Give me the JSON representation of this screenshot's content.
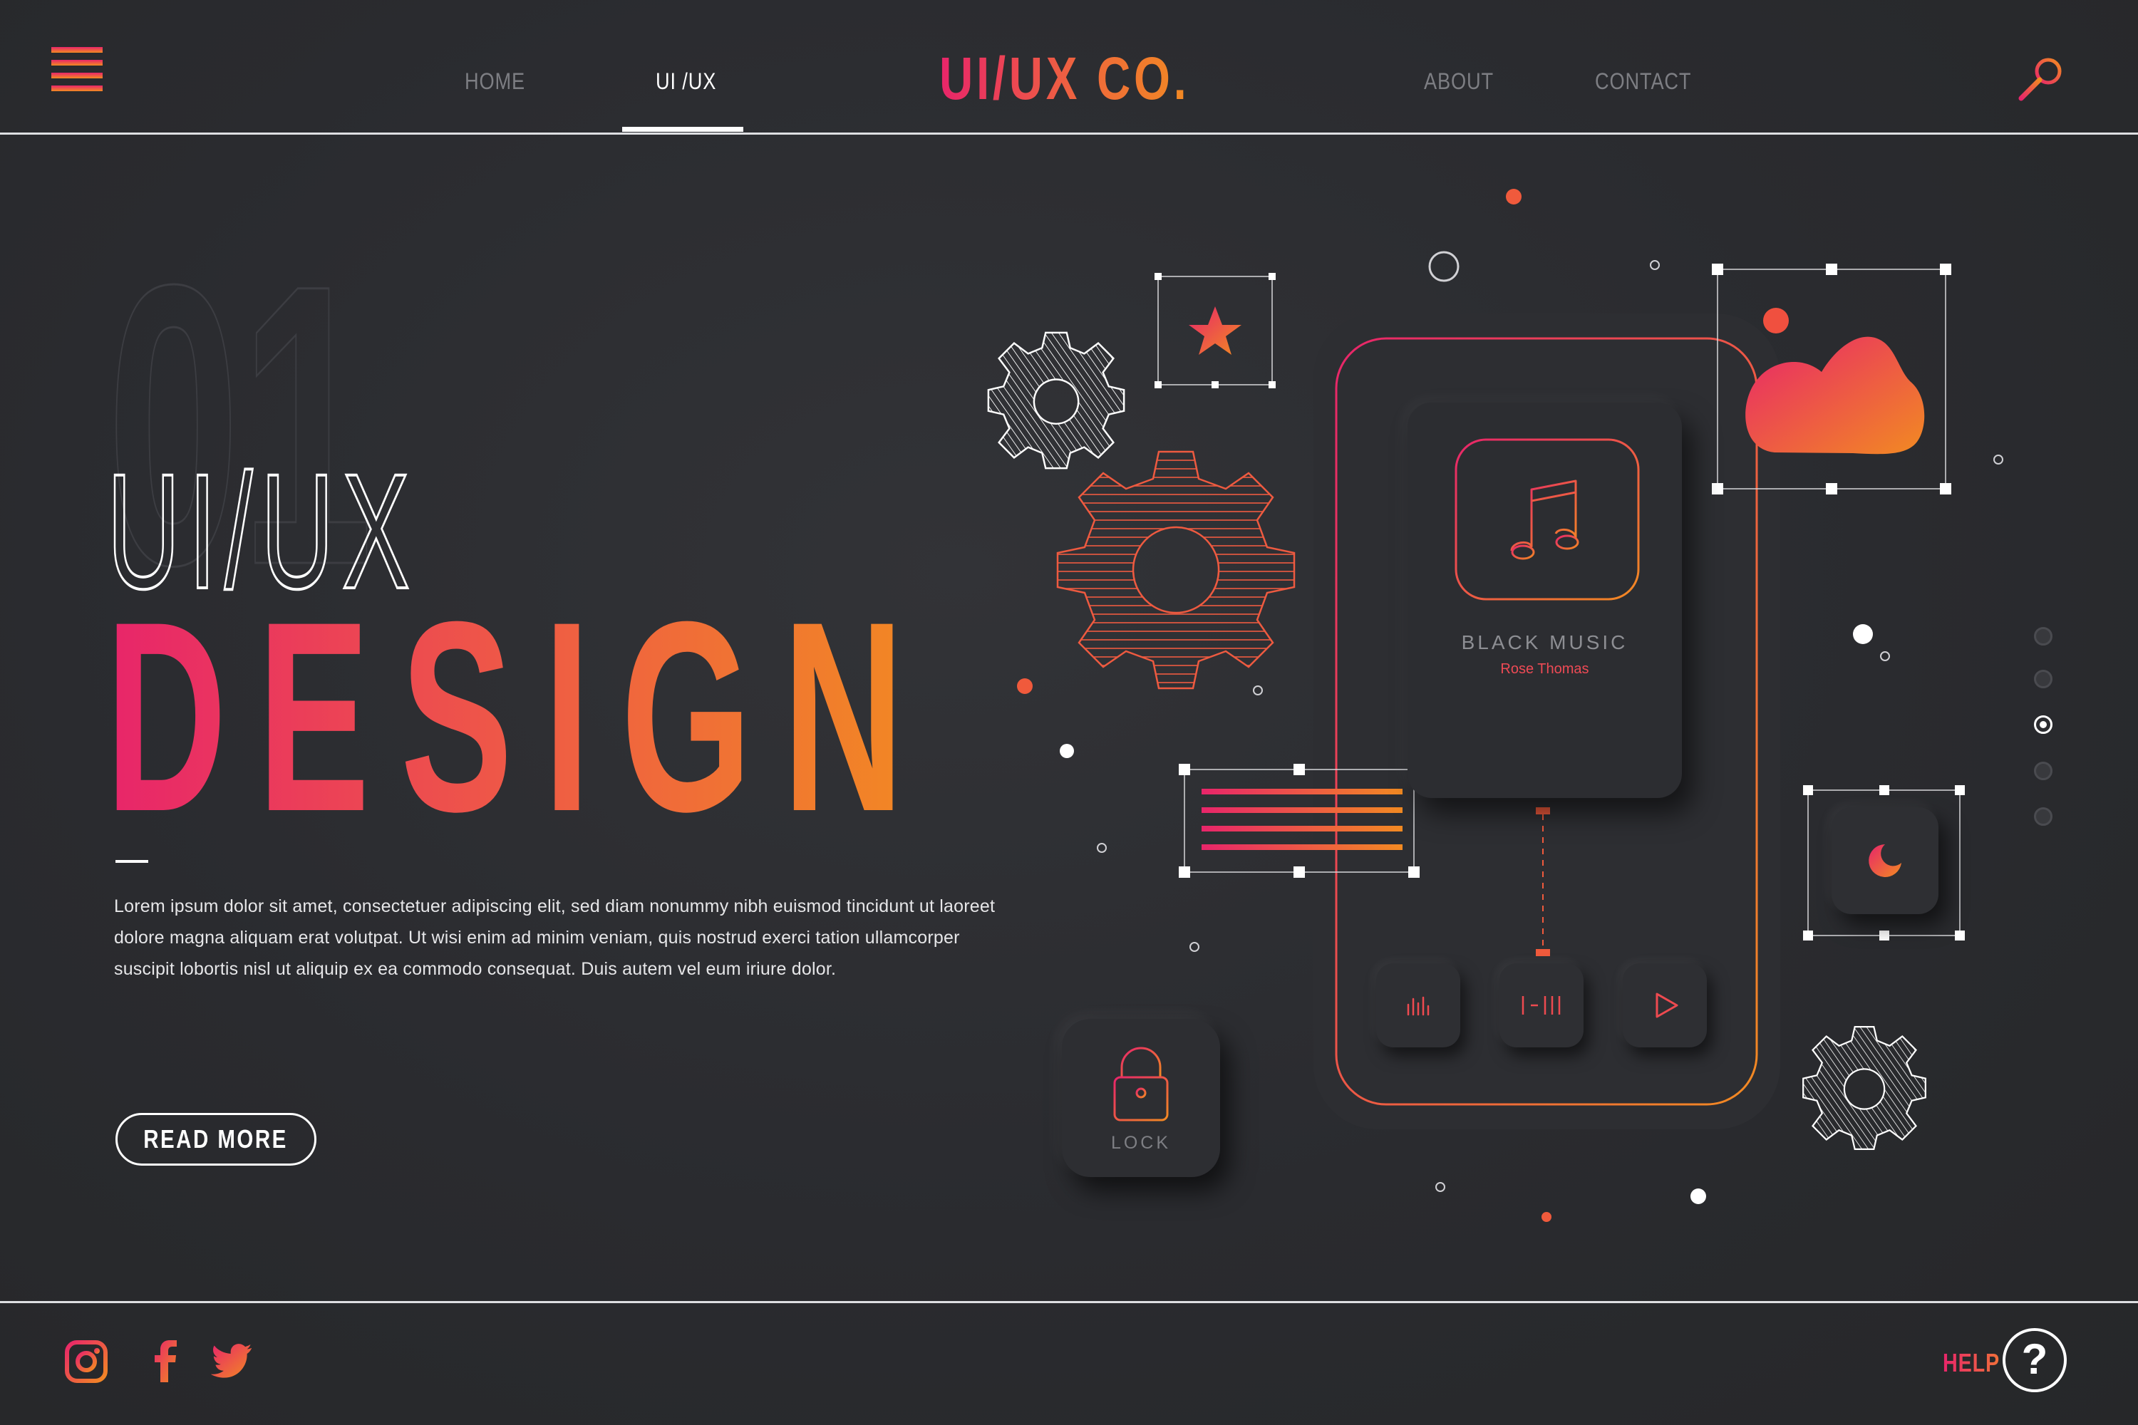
{
  "header": {
    "nav": [
      {
        "label": "HOME"
      },
      {
        "label": "UI /UX"
      },
      {
        "label": "ABOUT"
      },
      {
        "label": "CONTACT"
      }
    ],
    "brand": "UI/UX CO."
  },
  "hero": {
    "number": "01",
    "title_line1": "UI/UX",
    "title_line2": "DESIGN",
    "body": "Lorem ipsum dolor sit amet, consectetuer adipiscing elit, sed diam nonummy nibh euismod tincidunt ut laoreet dolore magna aliquam erat volutpat. Ut wisi enim ad minim veniam, quis nostrud exerci tation ullamcorper suscipit lobortis nisl ut aliquip ex ea commodo consequat. Duis autem vel eum iriure dolor.",
    "cta": "READ MORE"
  },
  "phone": {
    "track_title": "BLACK MUSIC",
    "artist": "Rose Thomas"
  },
  "lock": {
    "label": "LOCK"
  },
  "pager": {
    "count": 5,
    "active_index": 2
  },
  "footer": {
    "social": [
      "instagram-icon",
      "facebook-icon",
      "twitter-icon"
    ],
    "help_label": "HELP",
    "help_symbol": "?"
  },
  "colors": {
    "accent_start": "#e8256a",
    "accent_end": "#f28a22",
    "background": "#2b2c30",
    "text": "#ffffff"
  }
}
